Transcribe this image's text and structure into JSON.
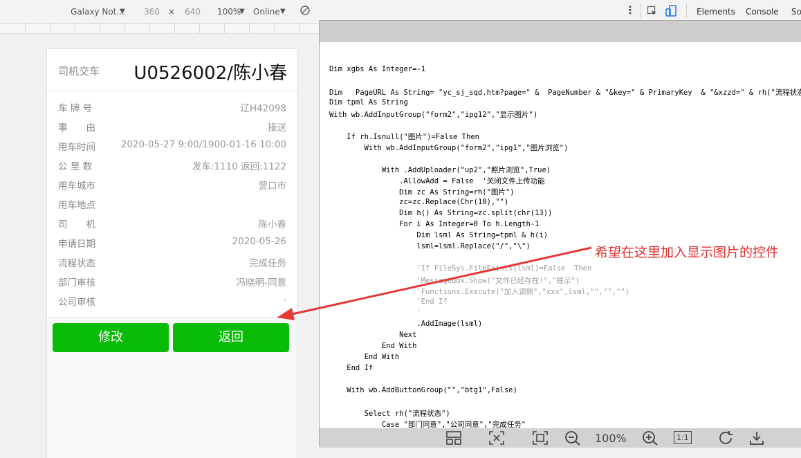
{
  "devtools": {
    "device": "Galaxy Not...",
    "width": "360",
    "times": "×",
    "height": "640",
    "zoom": "100%",
    "throttle": "Online",
    "dropdown": "▼",
    "tab_elements": "Elements",
    "tab_console": "Console",
    "tab_sources": "So"
  },
  "phone": {
    "header_label": "司机交车",
    "header_title": "U0526002/陈小春",
    "rows": [
      {
        "label": "车 牌 号",
        "value": "辽H42098"
      },
      {
        "label": "事　　由",
        "value": "接送"
      },
      {
        "label": "用车时间",
        "value": "2020-05-27 9:00/1900-01-16 10:00"
      },
      {
        "label": "公 里 数",
        "value": "发车:1110 返回:1122"
      },
      {
        "label": "用车城市",
        "value": "营口市"
      },
      {
        "label": "用车地点",
        "value": ""
      },
      {
        "label": "司　　机",
        "value": "陈小春"
      },
      {
        "label": "申请日期",
        "value": "2020-05-26"
      },
      {
        "label": "流程状态",
        "value": "完成任务"
      },
      {
        "label": "部门审核",
        "value": "冯晓明-同意"
      },
      {
        "label": "公司审核",
        "value": "-"
      }
    ],
    "btn_edit": "修改",
    "btn_back": "返回"
  },
  "code": {
    "l1": "Dim xgbs As Integer=-1",
    "l2": "Dim   PageURL As String= \"yc_sj_sqd.htm?page=\" &  PageNumber & \"&key=\" & PrimaryKey  & \"&xzzd=\" & rh(\"流程状态\")",
    "l3": "Dim tpml As String",
    "l4": "With wb.AddInputGroup(\"form2\",\"ipg12\",\"显示图片\")",
    "l5": "    If rh.Isnull(\"图片\")=False Then",
    "l6": "        With wb.AddInputGroup(\"form2\",\"ipg1\",\"图片浏览\")",
    "l7": "            With .AddUploader(\"up2\",\"照片浏览\",True)",
    "l8": "                .AllowAdd = False  '关闭文件上传功能",
    "l9": "                Dim zc As String=rh(\"图片\")",
    "l10": "                zc=zc.Replace(Chr(10),\"\")",
    "l11": "                Dim h() As String=zc.split(chr(13))",
    "l12": "                For i As Integer=0 To h.Length-1",
    "l13": "                    Dim lsml As String=tpml & h(i)",
    "l14": "                    lsml=lsml.Replace(\"/\",\"\\\")",
    "l15": "                    'If FileSys.FileExists(lsml)=False  Then",
    "l16": "                    'Messagebox.Show(\"文件已经存在!\",\"提示\")",
    "l17": "                    'Functions.Execute(\"加入调侧\",\"xxx\",lsml,\"\",\"\",\"\")",
    "l18": "                    'End If",
    "l19": "                    '",
    "l20": "                    .AddImage(lsml)",
    "l21": "                Next",
    "l22": "            End With",
    "l23": "        End With",
    "l24": "    End If",
    "l25": "    With wb.AddButtonGroup(\"\",\"btg1\",False)",
    "l26": "        Select rh(\"流程状态\")",
    "l27": "            Case \"部门同意\",\"公司同意\",\"完成任务\""
  },
  "viewer": {
    "zoom": "100%",
    "actual_size": "1:1"
  },
  "annotation": "希望在这里加入显示图片的控件",
  "colors": {
    "accent_green": "#09bb07",
    "annotation_red": "#e03030",
    "keyword_blue": "#0000cc"
  }
}
